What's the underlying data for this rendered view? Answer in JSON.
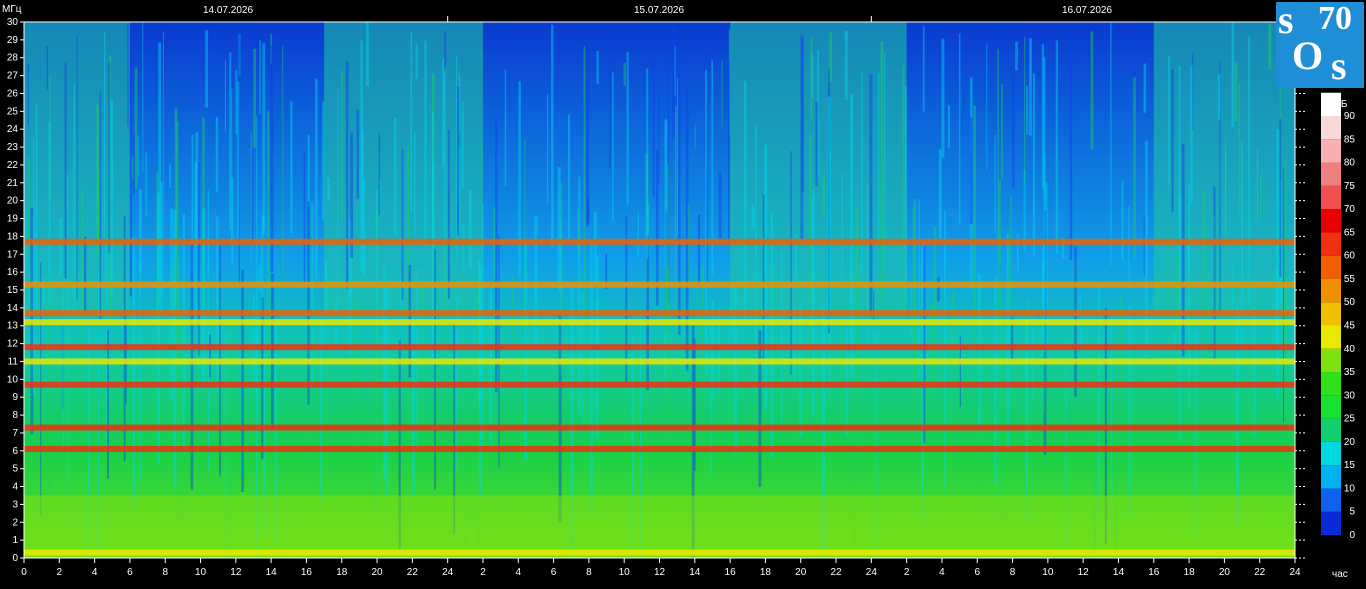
{
  "dates": [
    "14.07.2026",
    "15.07.2026",
    "16.07.2026"
  ],
  "logo": {
    "s1": "s",
    "num": "70",
    "o": "O",
    "s2": "s"
  },
  "chart_data": {
    "type": "heatmap",
    "title": "",
    "xlabel": "час",
    "ylabel": "МГц",
    "colorbar_label": "дБ",
    "x_ticks": [
      "0",
      "2",
      "4",
      "6",
      "8",
      "10",
      "12",
      "14",
      "16",
      "18",
      "20",
      "22",
      "24",
      "2",
      "4",
      "6",
      "8",
      "10",
      "12",
      "14",
      "16",
      "18",
      "20",
      "22",
      "24",
      "2",
      "4",
      "6",
      "8",
      "10",
      "12",
      "14",
      "16",
      "18",
      "20",
      "22",
      "24"
    ],
    "y_ticks": [
      "0",
      "1",
      "2",
      "3",
      "4",
      "5",
      "6",
      "7",
      "8",
      "9",
      "10",
      "11",
      "12",
      "13",
      "14",
      "15",
      "16",
      "17",
      "18",
      "19",
      "20",
      "21",
      "22",
      "23",
      "24",
      "25",
      "26",
      "27",
      "28",
      "29",
      "30"
    ],
    "ylim": [
      0,
      30
    ],
    "xlim_hours": [
      0,
      72
    ],
    "colorbar_ticks": [
      "0",
      "5",
      "10",
      "15",
      "20",
      "25",
      "30",
      "35",
      "40",
      "45",
      "50",
      "55",
      "60",
      "65",
      "70",
      "75",
      "80",
      "85",
      "90"
    ],
    "colorbar_range": [
      0,
      90
    ],
    "colorbar_colors": [
      "#0a2ad8",
      "#1060f0",
      "#00b0f0",
      "#00d8e0",
      "#10d070",
      "#18e030",
      "#30e018",
      "#80e010",
      "#e8e800",
      "#f0c000",
      "#f09000",
      "#f06000",
      "#f03010",
      "#e80000",
      "#f05050",
      "#f08080",
      "#f8b0b0",
      "#f8d8d8",
      "#ffffff"
    ]
  }
}
